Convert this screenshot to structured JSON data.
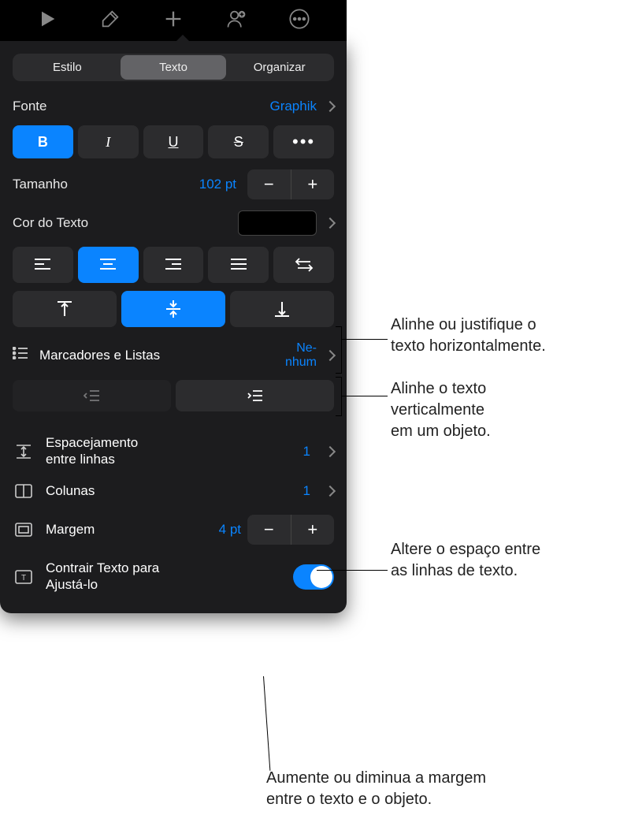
{
  "toolbar_icons": [
    "play-icon",
    "brush-icon",
    "plus-icon",
    "collaborate-icon",
    "more-icon"
  ],
  "tabs": {
    "style": "Estilo",
    "text": "Texto",
    "arrange": "Organizar"
  },
  "font": {
    "label": "Fonte",
    "value": "Graphik"
  },
  "style_buttons": {
    "bold": "B",
    "italic": "I",
    "underline": "U",
    "strike": "S",
    "more": "•••"
  },
  "size": {
    "label": "Tamanho",
    "value": "102 pt"
  },
  "text_color": {
    "label": "Cor do Texto"
  },
  "bullets": {
    "label": "Marcadores e Listas",
    "value": "Ne-\nnhum"
  },
  "line_spacing": {
    "label": "Espacejamento\nentre linhas",
    "value": "1"
  },
  "columns": {
    "label": "Colunas",
    "value": "1"
  },
  "margin": {
    "label": "Margem",
    "value": "4 pt"
  },
  "shrink": {
    "label": "Contrair Texto para\nAjustá-lo"
  },
  "callouts": {
    "halign": "Alinhe ou justifique o\ntexto horizontalmente.",
    "valign": "Alinhe o texto\nverticalmente\nem um objeto.",
    "linespace": "Altere o espaço entre\nas linhas de texto.",
    "margin": "Aumente ou diminua a margem\nentre o texto e o objeto."
  }
}
